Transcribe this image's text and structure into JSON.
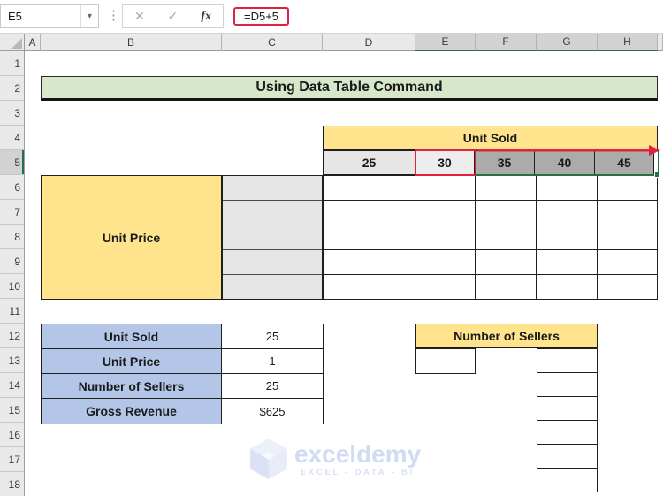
{
  "formula_bar": {
    "name_box_value": "E5",
    "dropdown_icon": "▾",
    "cancel_icon": "✕",
    "enter_icon": "✓",
    "fx_icon": "fx",
    "formula_value": "=D5+5"
  },
  "column_headers": [
    "A",
    "B",
    "C",
    "D",
    "E",
    "F",
    "G",
    "H"
  ],
  "selected_columns": [
    "E",
    "F",
    "G",
    "H"
  ],
  "row_headers": [
    "1",
    "2",
    "3",
    "4",
    "5",
    "6",
    "7",
    "8",
    "9",
    "10",
    "11",
    "12",
    "13",
    "14",
    "15",
    "16",
    "17",
    "18"
  ],
  "selected_row": "5",
  "sheet": {
    "title": "Using Data Table Command",
    "data_table": {
      "column_header": "Unit Sold",
      "column_values": [
        "25",
        "30",
        "35",
        "40",
        "45"
      ],
      "row_header": "Unit Price"
    },
    "summary": {
      "rows": [
        {
          "label": "Unit Sold",
          "value": "25"
        },
        {
          "label": "Unit Price",
          "value": "1"
        },
        {
          "label": "Number of Sellers",
          "value": "25"
        },
        {
          "label": "Gross Revenue",
          "value": "$625"
        }
      ]
    },
    "sellers_header": "Number of Sellers"
  },
  "watermark": {
    "brand": "exceldemy",
    "tagline": "EXCEL - DATA - BI"
  },
  "colors": {
    "excel_green": "#217346",
    "annotation_red": "#e0233c",
    "header_yellow": "#ffe48d",
    "label_blue": "#b4c6e7",
    "title_green": "#d6e7ca",
    "cell_gray": "#e7e6e6",
    "selected_cell_gray": "#ababab"
  }
}
